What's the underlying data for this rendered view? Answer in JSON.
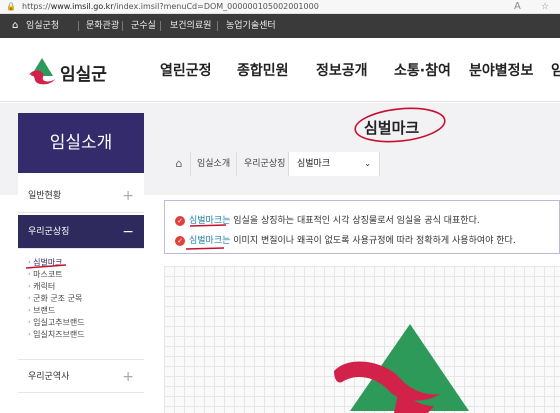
{
  "browser": {
    "url_prefix": "https://",
    "url_domain": "www.imsil.go.kr",
    "url_path": "/index.imsil?menuCd=DOM_000000105002001000"
  },
  "topbar": {
    "items": [
      "임실군청",
      "문화관광",
      "군수실",
      "보건의료원",
      "농업기술센터"
    ]
  },
  "header": {
    "logo_text": "임실군",
    "nav": [
      "열린군정",
      "종합민원",
      "정보공개",
      "소통·참여",
      "분야별정보",
      "임"
    ]
  },
  "sidebar": {
    "title": "임실소개",
    "sections": [
      {
        "label": "일반현황",
        "toggle": "+"
      },
      {
        "label": "우리군상징",
        "toggle": "−"
      },
      {
        "label": "우리군역사",
        "toggle": "+"
      }
    ],
    "sub_items": [
      "심벌마크",
      "마스코트",
      "캐릭터",
      "군화 군조 군목",
      "브랜드",
      "임실고추브랜드",
      "임실치즈브랜드"
    ]
  },
  "content": {
    "page_title": "심벌마크",
    "breadcrumb": [
      "임실소개",
      "우리군상징"
    ],
    "breadcrumb_select": "심벌마크",
    "notices": [
      {
        "keyword": "심벌마크는",
        "text": " 임실을 상징하는 대표적인 시각 상징물로서 임실을 공식 대표한다."
      },
      {
        "keyword": "심벌마크는",
        "text": " 이미지 변질이나 왜곡이 없도록 사용규정에 따라 정확하게 사용하여야 한다."
      }
    ]
  },
  "colors": {
    "sidebar_head": "#332b6b",
    "topbar": "#3a3a3a",
    "emblem_green": "#2e9a5a",
    "emblem_red": "#d2224a",
    "annotation": "#c8102e"
  }
}
